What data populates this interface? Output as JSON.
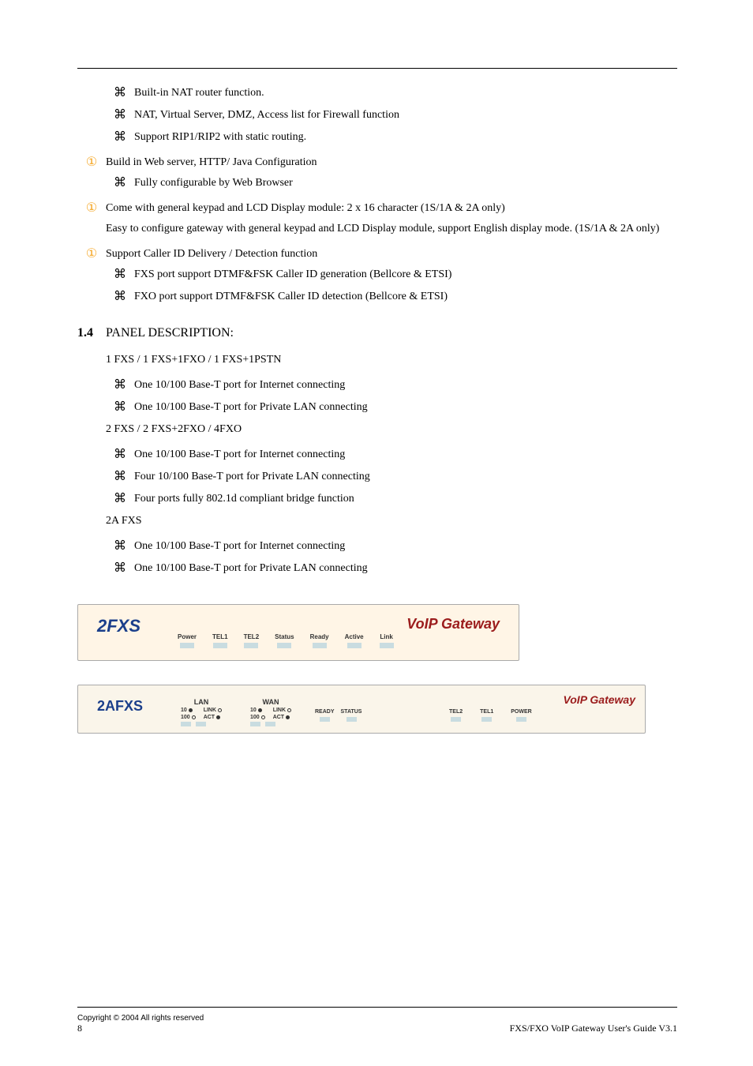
{
  "bullets_top": [
    {
      "sym": "⌘",
      "text": "Built-in NAT router function."
    },
    {
      "sym": "⌘",
      "text": "NAT, Virtual Server, DMZ, Access list for Firewall function"
    },
    {
      "sym": "⌘",
      "text": "Support RIP1/RIP2 with static routing."
    }
  ],
  "b1": {
    "heading": "Build in Web server, HTTP/ Java Configuration",
    "sym_head": "①",
    "items": [
      {
        "sym": "⌘",
        "text": "Fully configurable by Web Browser"
      }
    ]
  },
  "b2": {
    "heading": "Come with general keypad and LCD Display module: 2 x 16 character (1S/1A & 2A only)",
    "sym_head": "①",
    "para": "Easy to configure gateway with general keypad and LCD Display module, support English display mode. (1S/1A & 2A only)"
  },
  "b3": {
    "heading": "Support Caller ID Delivery / Detection function",
    "sym_head": "①",
    "items": [
      {
        "sym": "⌘",
        "text": "FXS port support DTMF&FSK Caller ID generation (Bellcore & ETSI)"
      },
      {
        "sym": "⌘",
        "text": "FXO port support DTMF&FSK Caller ID detection (Bellcore & ETSI)"
      }
    ]
  },
  "section": {
    "label": "1.4",
    "title": "PANEL DESCRIPTION:"
  },
  "lists": [
    {
      "title": "1 FXS / 1 FXS+1FXO / 1 FXS+1PSTN",
      "items": [
        {
          "sym": "⌘",
          "text": "One 10/100 Base-T port for Internet connecting"
        },
        {
          "sym": "⌘",
          "text": "One 10/100 Base-T port for Private LAN connecting"
        }
      ]
    },
    {
      "title": "2 FXS / 2 FXS+2FXO / 4FXO",
      "items": [
        {
          "sym": "⌘",
          "text": "One 10/100 Base-T port for Internet connecting"
        },
        {
          "sym": "⌘",
          "text": "Four 10/100 Base-T port for Private LAN connecting"
        },
        {
          "sym": "⌘",
          "text": "Four ports fully 802.1d compliant bridge function"
        }
      ]
    },
    {
      "title": "2A FXS",
      "items": [
        {
          "sym": "⌘",
          "text": "One 10/100 Base-T port for Internet connecting"
        },
        {
          "sym": "⌘",
          "text": "One 10/100 Base-T port for Private LAN connecting"
        }
      ]
    }
  ],
  "panel_a": {
    "brand": "2FXS",
    "gateway": "VoIP Gateway",
    "leds": [
      "Power",
      "TEL1",
      "TEL2",
      "Status",
      "Ready",
      "Active",
      "Link"
    ]
  },
  "panel_b": {
    "brand": "2AFXS",
    "gateway": "VoIP Gateway",
    "lan_title": "LAN",
    "wan_title": "WAN",
    "ten": "10",
    "hundred": "100",
    "link": "LINK",
    "act": "ACT",
    "status": [
      "READY",
      "STATUS"
    ],
    "right": [
      "TEL2",
      "TEL1",
      "POWER"
    ]
  },
  "footer": {
    "copyright": "Copyright © 2004 All rights reserved",
    "pagenum": "8",
    "doc": "FXS/FXO VoIP Gateway User's Guide V3.1"
  }
}
